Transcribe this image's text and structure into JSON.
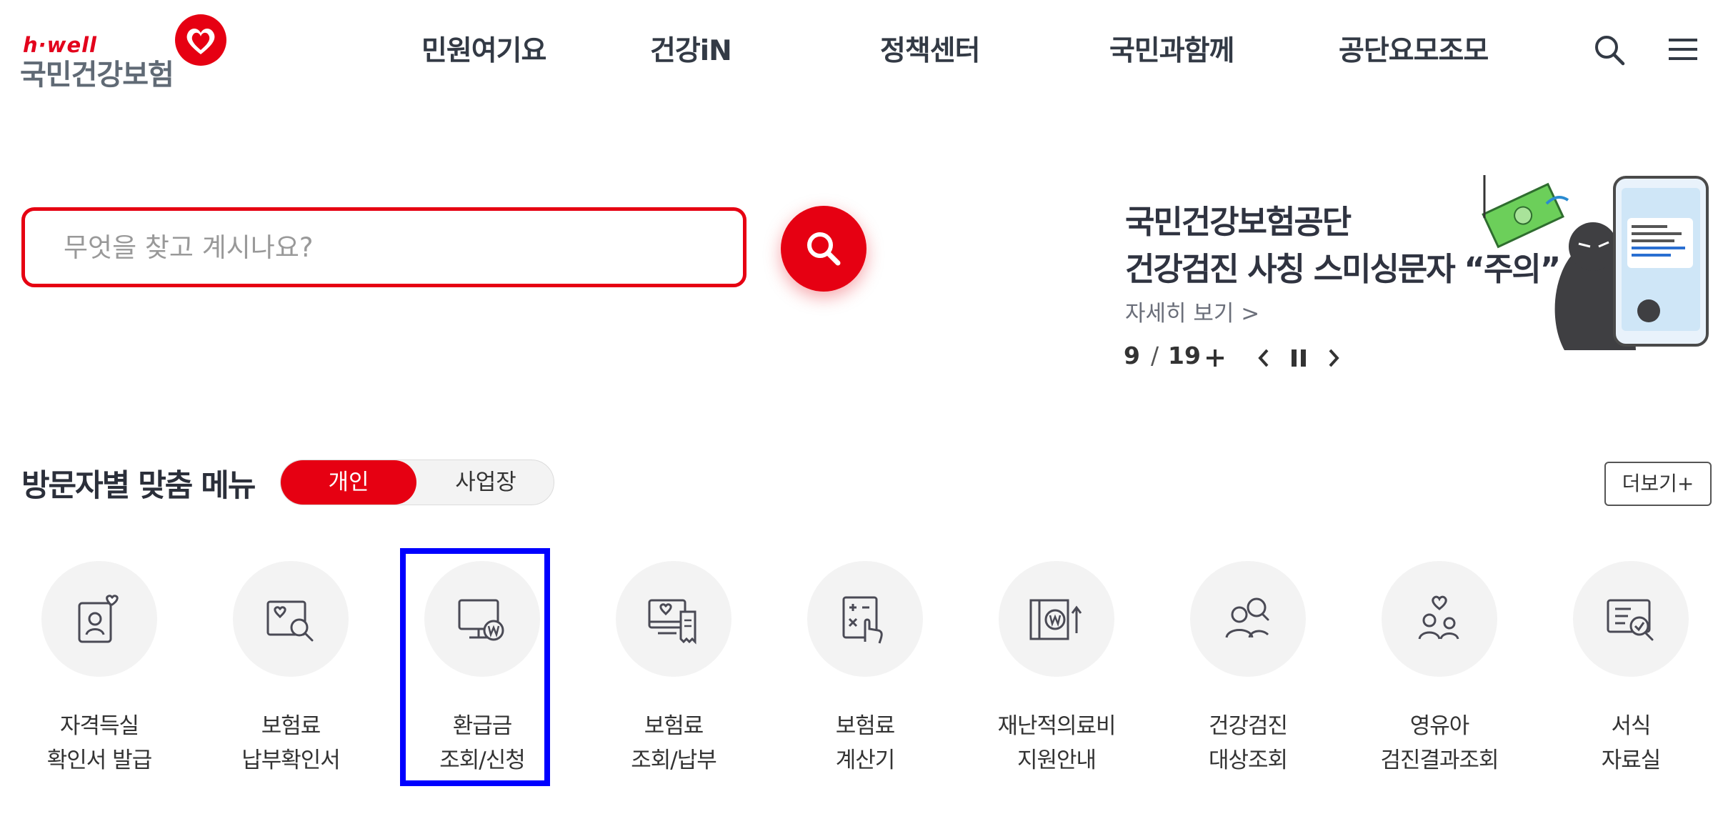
{
  "header": {
    "logo_tag": "h·well",
    "logo_text": "국민건강보험",
    "nav": [
      "민원여기요",
      "건강iN",
      "정책센터",
      "국민과함께",
      "공단요모조모"
    ],
    "search_icon": "search-icon",
    "menu_icon": "hamburger-menu-icon"
  },
  "search": {
    "placeholder": "무엇을 찾고 계시나요?",
    "value": "",
    "submit_icon": "search-icon"
  },
  "banner": {
    "title_line1": "국민건강보험공단",
    "title_line2": "건강검진 사칭 스미싱문자 “주의”",
    "more": "자세히 보기 >",
    "pager_current": "9",
    "pager_sep": "/",
    "pager_total": "19",
    "controls": [
      "plus-icon",
      "prev-icon",
      "pause-icon",
      "next-icon"
    ]
  },
  "visitor_menu": {
    "title": "방문자별 맞춤 메뉴",
    "toggle": [
      "개인",
      "사업장"
    ],
    "selected": "개인",
    "more_button": "더보기+",
    "items": [
      {
        "line1": "자격득실",
        "line2": "확인서 발급",
        "icon": "id-card-heart-icon"
      },
      {
        "line1": "보험료",
        "line2": "납부확인서",
        "icon": "document-search-icon"
      },
      {
        "line1": "환급금",
        "line2": "조회/신청",
        "icon": "monitor-won-icon"
      },
      {
        "line1": "보험료",
        "line2": "조회/납부",
        "icon": "monitor-receipt-icon"
      },
      {
        "line1": "보험료",
        "line2": "계산기",
        "icon": "calculator-hand-icon"
      },
      {
        "line1": "재난적의료비",
        "line2": "지원안내",
        "icon": "won-up-arrow-icon"
      },
      {
        "line1": "건강검진",
        "line2": "대상조회",
        "icon": "people-search-icon"
      },
      {
        "line1": "영유아",
        "line2": "검진결과조회",
        "icon": "family-heart-icon"
      },
      {
        "line1": "서식",
        "line2": "자료실",
        "icon": "document-check-icon"
      }
    ]
  },
  "colors": {
    "brand_red": "#e60012",
    "highlight_blue": "#0000ff",
    "text_dark": "#333a45",
    "icon_bg": "#f3f3f3"
  }
}
